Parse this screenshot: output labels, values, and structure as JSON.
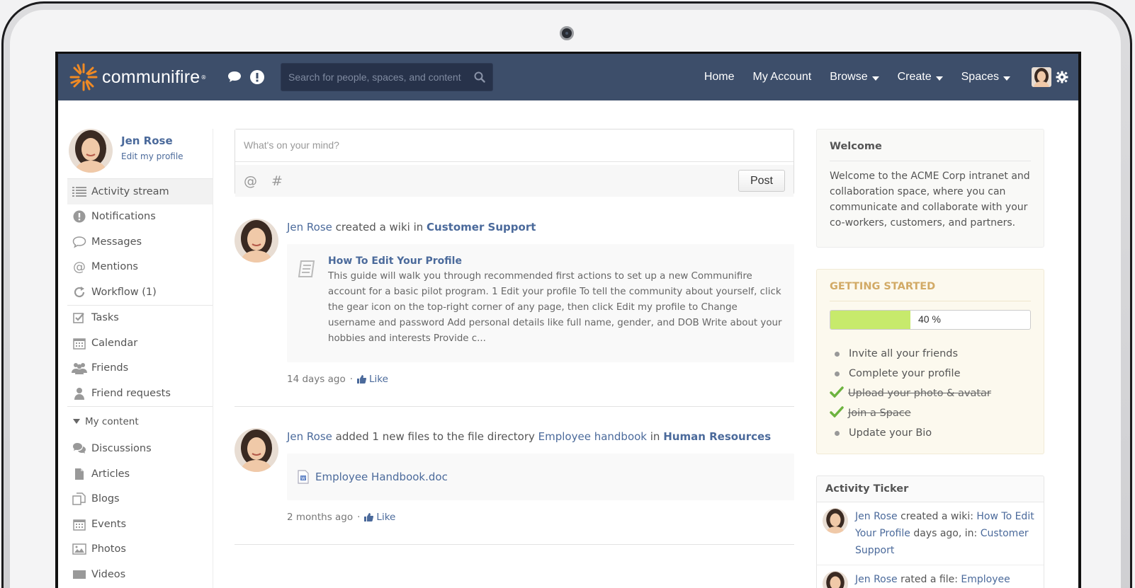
{
  "brand": {
    "name": "communifire",
    "reg": "®",
    "accent": "#f08a24"
  },
  "navbar": {
    "search_placeholder": "Search for people, spaces, and content",
    "links": [
      {
        "label": "Home",
        "dropdown": false
      },
      {
        "label": "My Account",
        "dropdown": false
      },
      {
        "label": "Browse",
        "dropdown": true
      },
      {
        "label": "Create",
        "dropdown": true
      },
      {
        "label": "Spaces",
        "dropdown": true
      }
    ],
    "bg_color": "#3d4e6a"
  },
  "sidebar": {
    "user_name": "Jen Rose",
    "edit_profile": "Edit my profile",
    "primary": [
      {
        "label": "Activity stream",
        "icon": "list-icon",
        "active": true
      },
      {
        "label": "Notifications",
        "icon": "exclamation-icon"
      },
      {
        "label": "Messages",
        "icon": "speech-bubble-icon"
      },
      {
        "label": "Mentions",
        "icon": "at-icon"
      },
      {
        "label": "Workflow (1)",
        "icon": "refresh-icon"
      }
    ],
    "secondary": [
      {
        "label": "Tasks",
        "icon": "checkbox-icon"
      },
      {
        "label": "Calendar",
        "icon": "calendar-icon"
      },
      {
        "label": "Friends",
        "icon": "people-icon"
      },
      {
        "label": "Friend requests",
        "icon": "person-icon"
      }
    ],
    "section_label": "My content",
    "content": [
      {
        "label": "Discussions",
        "icon": "chat-icon"
      },
      {
        "label": "Articles",
        "icon": "document-icon"
      },
      {
        "label": "Blogs",
        "icon": "blog-icon"
      },
      {
        "label": "Events",
        "icon": "calendar-icon"
      },
      {
        "label": "Photos",
        "icon": "photo-icon"
      },
      {
        "label": "Videos",
        "icon": "video-icon"
      }
    ]
  },
  "composer": {
    "placeholder": "What's on your mind?",
    "at": "@",
    "hash": "#",
    "post_label": "Post"
  },
  "feed": [
    {
      "actor": "Jen Rose",
      "action": " created a wiki in ",
      "target": "Customer Support",
      "title": "How To Edit Your Profile",
      "body": "This guide will walk you through recommended first actions to set up a new Communifire account for a basic pilot program. 1 Edit your profile To tell the community about yourself, click the gear icon on the top-right corner of any page, then click Edit my profile to Change username and password Add personal details like full name, gender, and DOB Write about your hobbies and interests Provide c...",
      "time": "14 days ago",
      "like": "Like"
    },
    {
      "actor": "Jen Rose",
      "action": " added 1 new files to the file directory ",
      "directory": "Employee handbook",
      "in": " in ",
      "target": "Human Resources",
      "file": "Employee Handbook.doc",
      "time": "2 months ago",
      "like": "Like"
    }
  ],
  "welcome": {
    "title": "Welcome",
    "text": "Welcome to the ACME Corp intranet and collaboration space, where you can communicate and collaborate with your co-workers, customers, and partners."
  },
  "getting_started": {
    "title": "GETTING STARTED",
    "progress_percent": 40,
    "progress_label": "40 %",
    "items": [
      {
        "label": "Invite all your friends",
        "done": false
      },
      {
        "label": "Complete your profile",
        "done": false
      },
      {
        "label": "Upload your photo & avatar",
        "done": true
      },
      {
        "label": "Join a Space",
        "done": true
      },
      {
        "label": "Update your Bio",
        "done": false
      }
    ]
  },
  "ticker": {
    "title": "Activity Ticker",
    "items": [
      {
        "actor": "Jen Rose",
        "action": " created a wiki: ",
        "link": "How To Edit Your Profile",
        "suffix": " days ago, in: ",
        "target": "Customer Support"
      },
      {
        "actor": "Jen Rose",
        "action": " rated a file: ",
        "link": "Employee",
        "suffix": "",
        "target": ""
      }
    ]
  }
}
